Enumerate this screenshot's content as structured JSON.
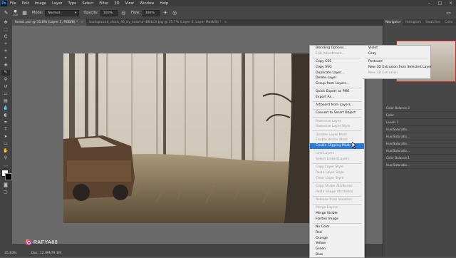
{
  "app": {
    "logo": "Ps"
  },
  "menubar": {
    "items": [
      "File",
      "Edit",
      "Image",
      "Layer",
      "Type",
      "Select",
      "Filter",
      "3D",
      "View",
      "Window",
      "Help"
    ]
  },
  "options_bar": {
    "brush_size": "300",
    "mode_label": "Mode:",
    "mode_value": "Normal",
    "opacity_label": "Opacity:",
    "opacity_value": "100%",
    "flow_label": "Flow:",
    "flow_value": "100%"
  },
  "tabs": [
    {
      "label": "forest.psd @ 35.8% (Layer 5, RGB/8) *",
      "close": "×"
    },
    {
      "label": "background_stock_46_by_kaismir-d8ktz3r.jpg @ 35.7% (Layer 0, Layer Mask/8) *",
      "close": "×"
    }
  ],
  "status": {
    "zoom": "35.83%",
    "doc": "Doc: 12.9M/79.1M"
  },
  "watermark": {
    "text": "RAFYA88"
  },
  "right_panel": {
    "tabs": [
      "Navigator",
      "Histogram",
      "Swatches",
      "Color"
    ],
    "layers": [
      "Color Balance 2",
      "Color",
      "Levels 1",
      "Hue/Saturatio...",
      "Hue/Saturatio...",
      "Hue/Saturatio...",
      "Hue/Saturatio...",
      "Color Balance 1",
      "Hue/Saturatio..."
    ]
  },
  "context_menu": {
    "items": [
      {
        "label": "Blending Options...",
        "state": "normal"
      },
      {
        "label": "Edit Adjustment...",
        "state": "disabled"
      },
      {
        "sep": true
      },
      {
        "label": "Copy CSS",
        "state": "normal"
      },
      {
        "label": "Copy SVG",
        "state": "normal"
      },
      {
        "label": "Duplicate Layer...",
        "state": "normal"
      },
      {
        "label": "Delete Layer",
        "state": "normal"
      },
      {
        "label": "Group from Layers...",
        "state": "normal"
      },
      {
        "sep": true
      },
      {
        "label": "Quick Export as PNG",
        "state": "normal"
      },
      {
        "label": "Export As...",
        "state": "normal"
      },
      {
        "sep": true
      },
      {
        "label": "Artboard from Layers...",
        "state": "normal"
      },
      {
        "sep": true
      },
      {
        "label": "Convert to Smart Object",
        "state": "normal"
      },
      {
        "sep": true
      },
      {
        "label": "Rasterize Layer",
        "state": "disabled"
      },
      {
        "label": "Rasterize Layer Style",
        "state": "disabled"
      },
      {
        "sep": true
      },
      {
        "label": "Disable Layer Mask",
        "state": "disabled"
      },
      {
        "label": "Enable Vector Mask",
        "state": "disabled"
      },
      {
        "label": "Create Clipping Mask",
        "state": "highlight"
      },
      {
        "sep": true
      },
      {
        "label": "Link Layers",
        "state": "disabled"
      },
      {
        "label": "Select Linked Layers",
        "state": "disabled"
      },
      {
        "sep": true
      },
      {
        "label": "Copy Layer Style",
        "state": "disabled"
      },
      {
        "label": "Paste Layer Style",
        "state": "disabled"
      },
      {
        "label": "Clear Layer Style",
        "state": "disabled"
      },
      {
        "sep": true
      },
      {
        "label": "Copy Shape Attributes",
        "state": "disabled"
      },
      {
        "label": "Paste Shape Attributes",
        "state": "disabled"
      },
      {
        "sep": true
      },
      {
        "label": "Release from Isolation",
        "state": "disabled"
      },
      {
        "sep": true
      },
      {
        "label": "Merge Layers",
        "state": "disabled"
      },
      {
        "label": "Merge Visible",
        "state": "normal"
      },
      {
        "label": "Flatten Image",
        "state": "normal"
      },
      {
        "sep": true
      },
      {
        "label": "No Color",
        "state": "normal"
      },
      {
        "label": "Red",
        "state": "normal"
      },
      {
        "label": "Orange",
        "state": "normal"
      },
      {
        "label": "Yellow",
        "state": "normal"
      },
      {
        "label": "Green",
        "state": "normal"
      },
      {
        "label": "Blue",
        "state": "normal"
      }
    ],
    "column2": [
      {
        "label": "Violet",
        "state": "normal"
      },
      {
        "label": "Gray",
        "state": "normal"
      },
      {
        "sep": true
      },
      {
        "label": "Postcard",
        "state": "normal"
      },
      {
        "label": "New 3D Extrusion from Selected Layer",
        "state": "normal"
      },
      {
        "label": "New 3D Extrusion",
        "state": "disabled"
      }
    ]
  },
  "colors": {
    "highlight": "#2a79d6",
    "panel": "#474747",
    "canvas_bg": "#6a6a6a"
  }
}
